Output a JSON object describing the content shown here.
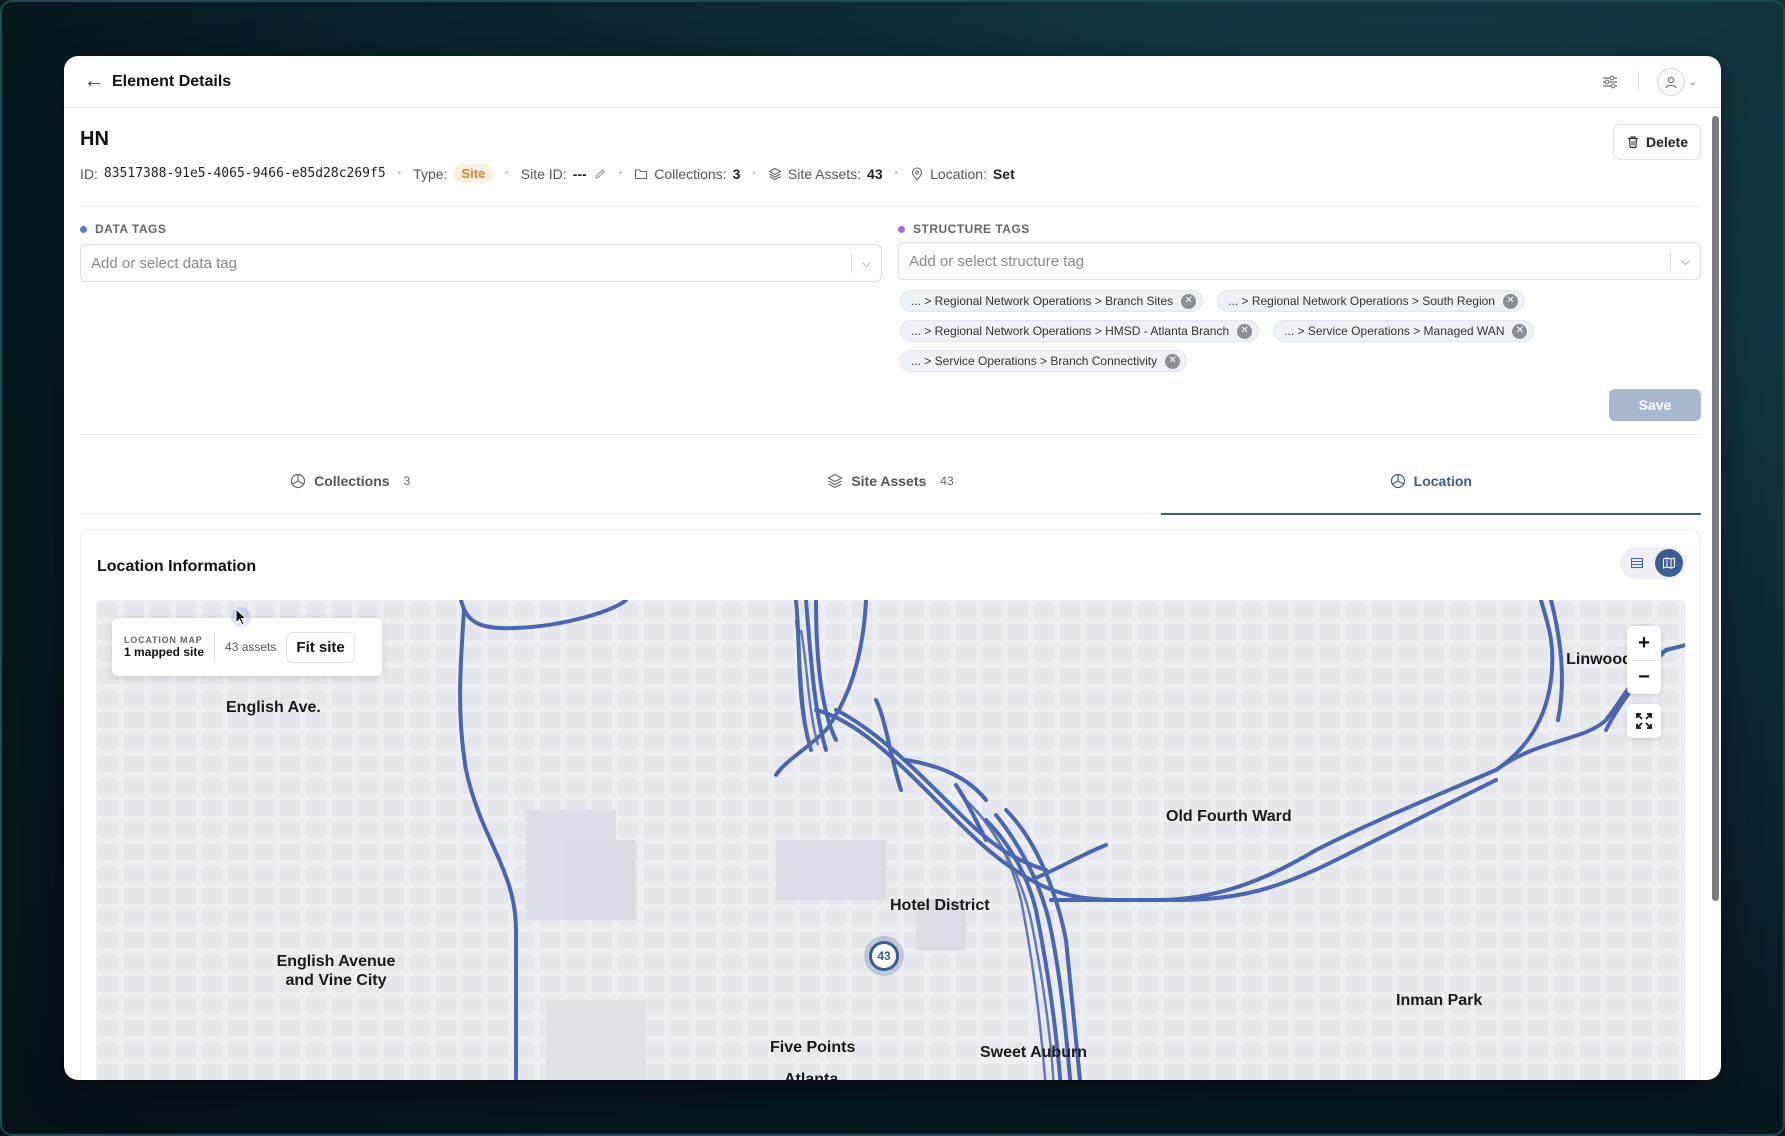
{
  "header": {
    "title": "Element Details"
  },
  "element": {
    "name": "HN",
    "id_label": "ID:",
    "id_value": "83517388-91e5-4065-9466-e85d28c269f5",
    "type_label": "Type:",
    "type_value": "Site",
    "site_id_label": "Site ID:",
    "site_id_value": "---",
    "collections_label": "Collections:",
    "collections_value": "3",
    "site_assets_label": "Site Assets:",
    "site_assets_value": "43",
    "location_label": "Location:",
    "location_value": "Set",
    "delete_label": "Delete"
  },
  "data_tags": {
    "label": "DATA TAGS",
    "placeholder": "Add or select data tag",
    "dot_color": "#5b7fc0"
  },
  "structure_tags": {
    "label": "STRUCTURE TAGS",
    "placeholder": "Add or select structure tag",
    "dot_color": "#a06ad6",
    "chips": [
      "... > Regional Network Operations > Branch Sites",
      "... > Regional Network Operations > South Region",
      "... > Regional Network Operations > HMSD - Atlanta Branch",
      "... > Service Operations > Managed WAN",
      "... > Service Operations > Branch Connectivity"
    ]
  },
  "save_label": "Save",
  "tabs": [
    {
      "label": "Collections",
      "count": "3",
      "icon": "collection-icon"
    },
    {
      "label": "Site Assets",
      "count": "43",
      "icon": "layers-icon"
    },
    {
      "label": "Location",
      "count": "",
      "icon": "location-icon"
    }
  ],
  "location": {
    "title": "Location Information",
    "map_info": {
      "eyebrow": "LOCATION MAP",
      "mapped": "1 mapped site",
      "assets": "43 assets",
      "fit_label": "Fit site"
    },
    "zoom_in": "+",
    "zoom_out": "−",
    "marker_count": "43",
    "labels": [
      "English Ave.",
      "Old Fourth Ward",
      "Hotel District",
      "English Avenue and Vine City",
      "Inman Park",
      "Five Points",
      "Sweet Auburn",
      "Atlanta",
      "Linwood"
    ]
  },
  "colors": {
    "accent": "#3c5d92",
    "road": "#4a67ae",
    "site_badge_bg": "#fdf0e0",
    "site_badge_fg": "#d9822b"
  }
}
